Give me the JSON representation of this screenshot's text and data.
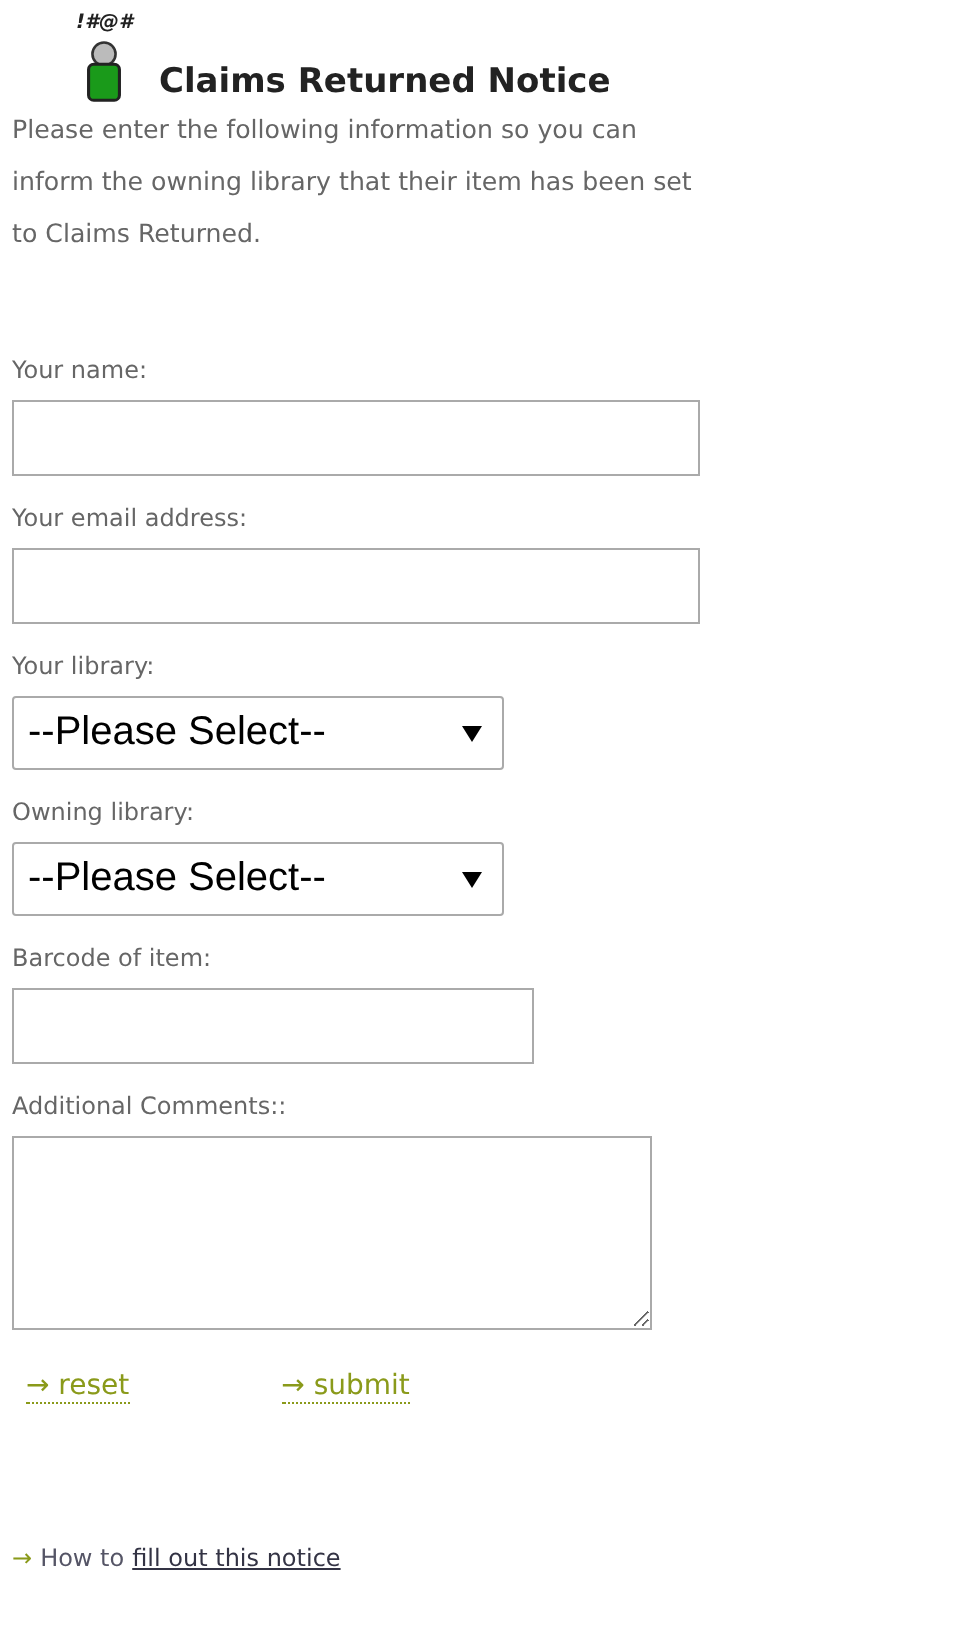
{
  "icon_symbols": "!#@#",
  "title": "Claims Returned Notice",
  "intro": "Please enter the following information so you can inform the owning library that their item has been set to Claims Returned.",
  "fields": [
    {
      "kind": "text",
      "label": "Your name:"
    },
    {
      "kind": "text",
      "label": "Your email address:"
    },
    {
      "kind": "select",
      "label": "Your library:",
      "value": "--Please Select--"
    },
    {
      "kind": "select",
      "label": "Owning library:",
      "value": "--Please Select--"
    },
    {
      "kind": "short_text",
      "label": "Barcode of item:"
    },
    {
      "kind": "textarea",
      "label": "Additional Comments::"
    }
  ],
  "actions": [
    {
      "arrow": "→",
      "label": "reset"
    },
    {
      "arrow": "→",
      "label": "submit"
    }
  ],
  "help": {
    "arrow": "→",
    "text": "How to",
    "link": "fill out this notice"
  }
}
